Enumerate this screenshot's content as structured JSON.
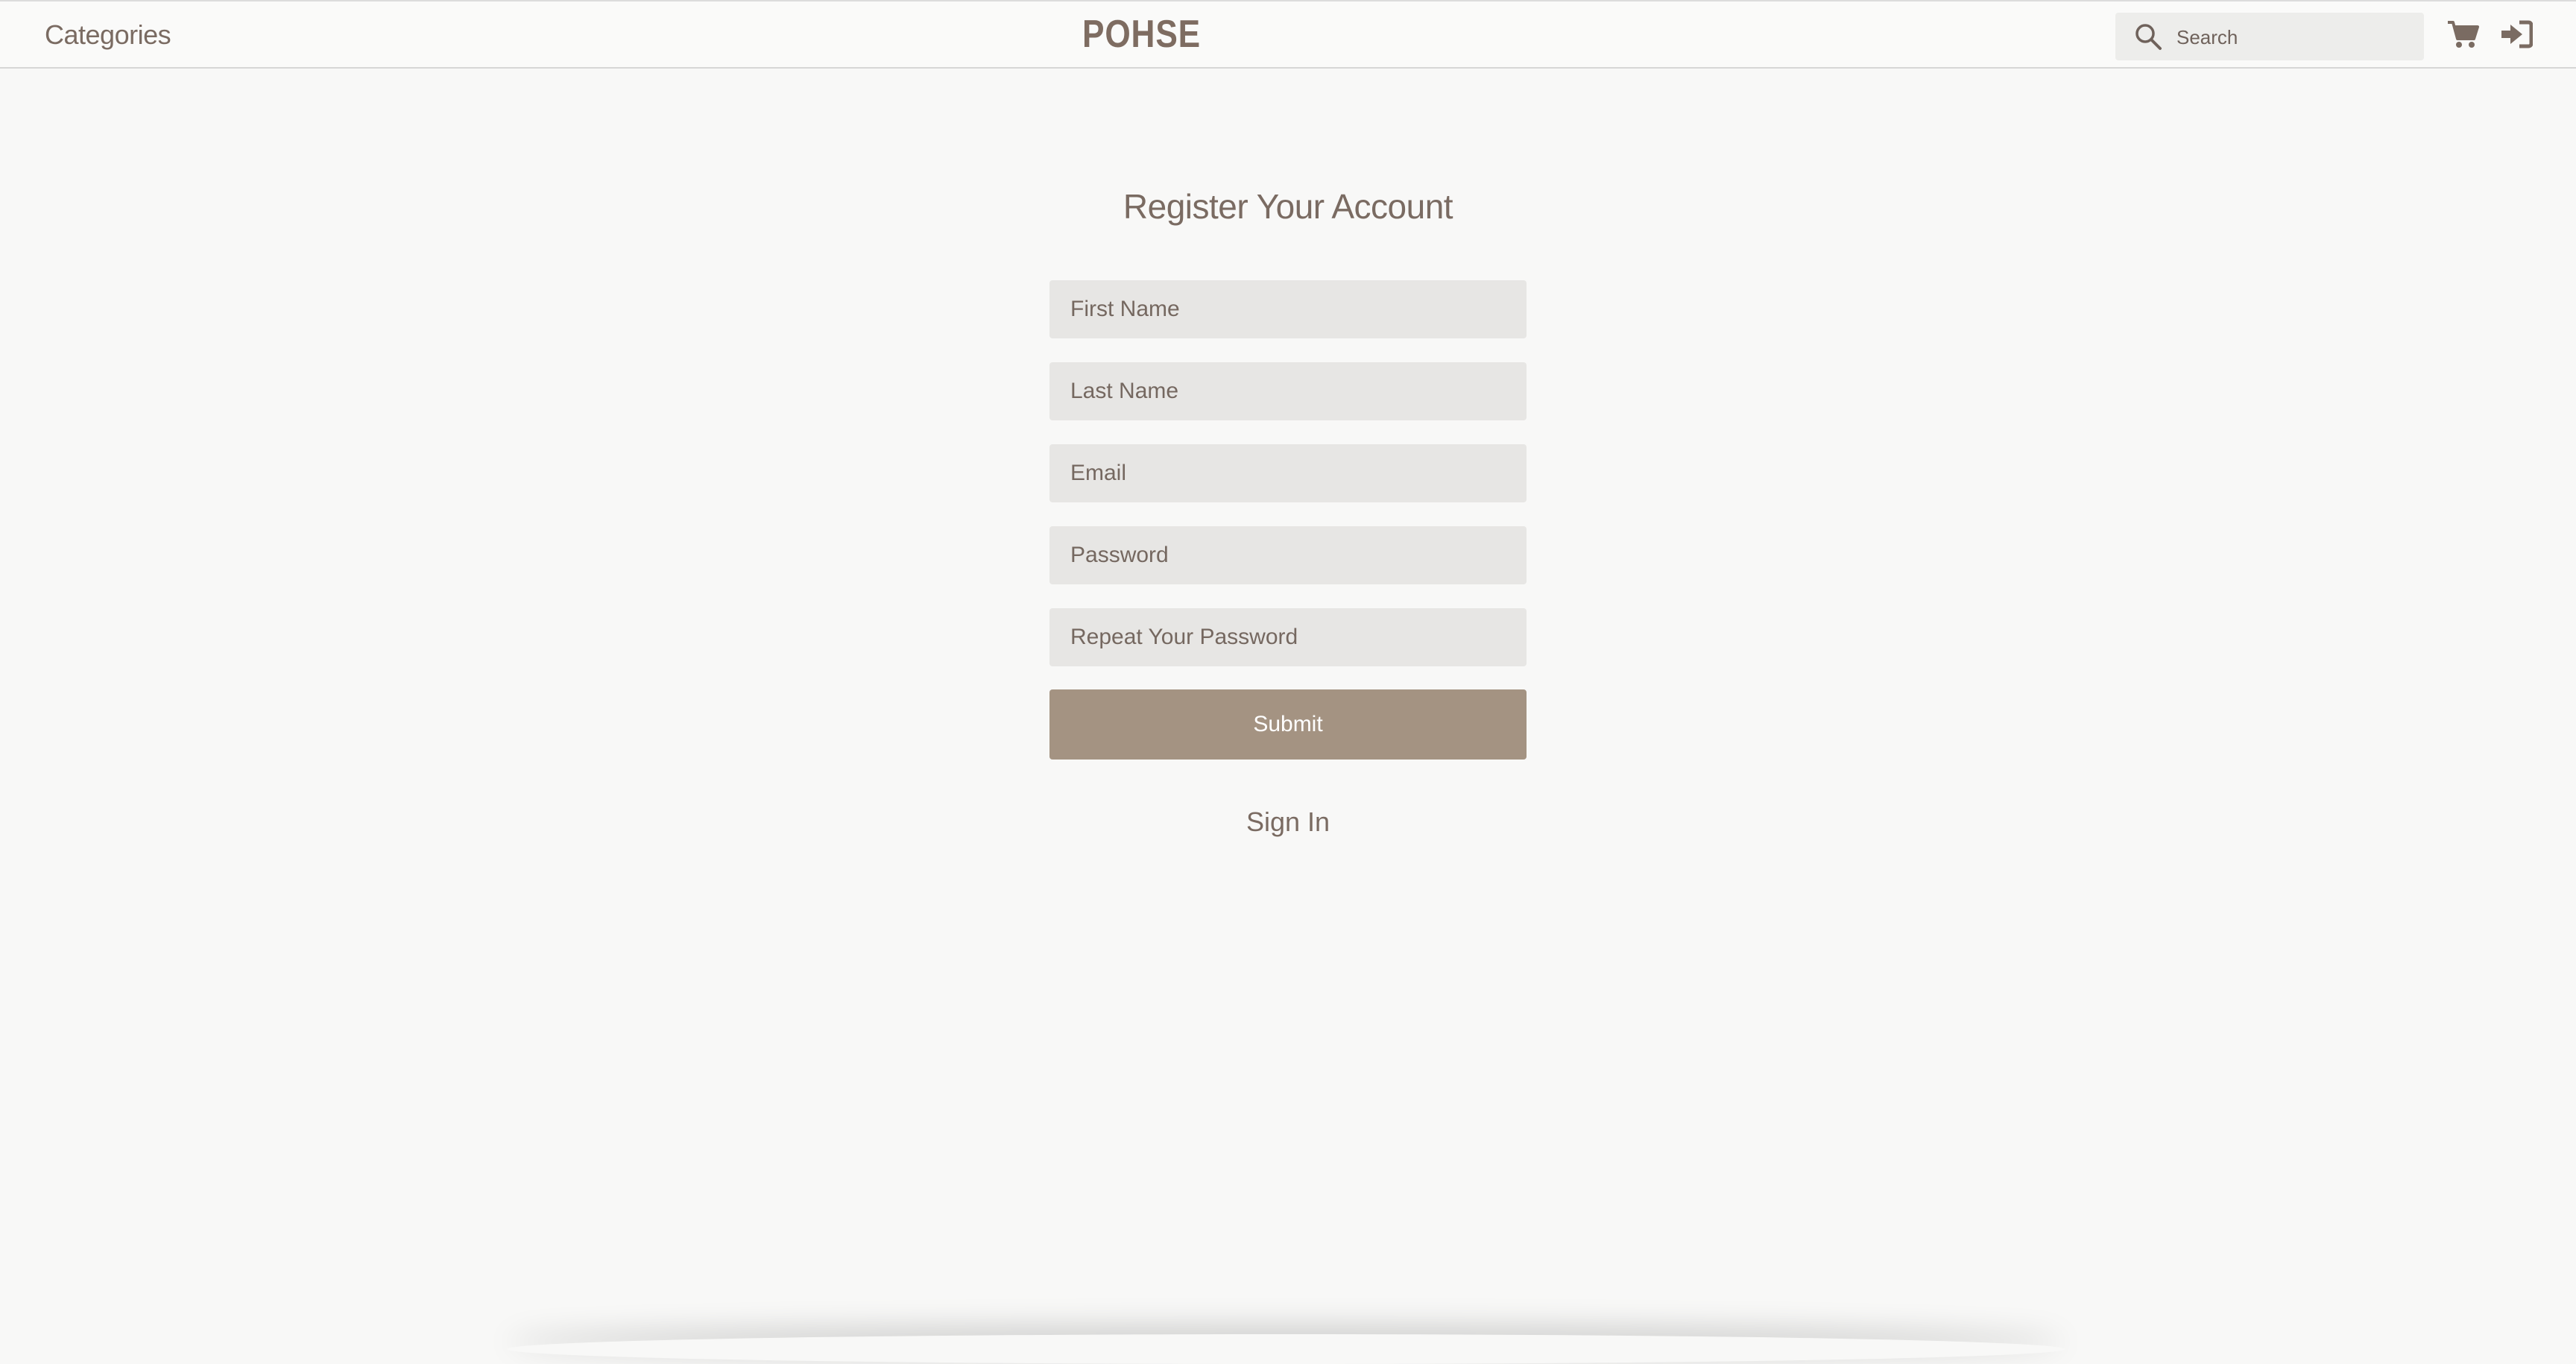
{
  "header": {
    "categories_label": "Categories",
    "logo": "POHSE",
    "search_placeholder": "Search",
    "icons": [
      "search-icon",
      "cart-icon",
      "sign-in-icon"
    ]
  },
  "form": {
    "title": "Register Your Account",
    "fields": [
      {
        "placeholder": "First Name"
      },
      {
        "placeholder": "Last Name"
      },
      {
        "placeholder": "Email"
      },
      {
        "placeholder": "Password"
      },
      {
        "placeholder": "Repeat Your Password"
      }
    ],
    "submit_label": "Submit",
    "signin_label": "Sign In"
  },
  "colors": {
    "accent": "#a49382",
    "text": "#7a6b62",
    "background": "#f8f8f7",
    "field_background": "#e7e6e4"
  }
}
